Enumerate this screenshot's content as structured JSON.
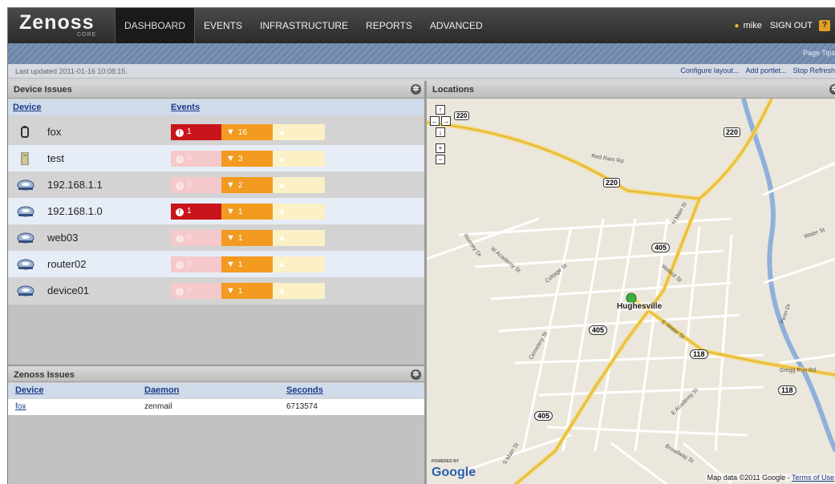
{
  "app": {
    "logo": "Zenoss",
    "logo_sub": "CORE"
  },
  "nav": [
    "DASHBOARD",
    "EVENTS",
    "INFRASTRUCTURE",
    "REPORTS",
    "ADVANCED"
  ],
  "user": {
    "name": "mike",
    "sign_out": "SIGN OUT",
    "help": "?"
  },
  "subbar": {
    "page_tips": "Page Tips"
  },
  "status": {
    "last_updated": "Last updated 2011-01-16 10:08:15.",
    "configure": "Configure layout...",
    "add_portlet": "Add portlet...",
    "stop_refresh": "Stop Refresh"
  },
  "device_issues": {
    "title": "Device Issues",
    "col_device": "Device",
    "col_events": "Events",
    "rows": [
      {
        "name": "fox",
        "icon": "battery-icon",
        "critical": "1",
        "error": "16",
        "warning": "",
        "crit_active": true
      },
      {
        "name": "test",
        "icon": "device-tower-icon",
        "critical": "0",
        "error": "3",
        "warning": "",
        "crit_active": false
      },
      {
        "name": "192.168.1.1",
        "icon": "server-disk-icon",
        "critical": "0",
        "error": "2",
        "warning": "",
        "crit_active": false
      },
      {
        "name": "192.168.1.0",
        "icon": "server-disk-icon",
        "critical": "1",
        "error": "1",
        "warning": "",
        "crit_active": true
      },
      {
        "name": "web03",
        "icon": "server-disk-icon",
        "critical": "0",
        "error": "1",
        "warning": "",
        "crit_active": false
      },
      {
        "name": "router02",
        "icon": "server-disk-icon",
        "critical": "0",
        "error": "1",
        "warning": "",
        "crit_active": false
      },
      {
        "name": "device01",
        "icon": "server-disk-icon",
        "critical": "0",
        "error": "1",
        "warning": "",
        "crit_active": false
      }
    ]
  },
  "zenoss_issues": {
    "title": "Zenoss Issues",
    "col_device": "Device",
    "col_daemon": "Daemon",
    "col_seconds": "Seconds",
    "rows": [
      {
        "device": "fox",
        "daemon": "zenmail",
        "seconds": "6713574"
      }
    ]
  },
  "locations": {
    "title": "Locations",
    "town": "Hughesville",
    "map_labels": [
      "Red Ram Rd",
      "N Main St",
      "E Water St",
      "S Main St",
      "Broadway St",
      "Gregg Run Rd",
      "E Academy St",
      "Walnut St",
      "Cemetery St",
      "W Academy St",
      "Cottage St",
      "Rooney Dr",
      "Penn Dr",
      "Water St"
    ],
    "route_shields": [
      "220",
      "220",
      "220",
      "405",
      "405",
      "405",
      "118",
      "118"
    ],
    "powered_by": "POWERED BY",
    "google": "Google",
    "map_data": "Map data ©2011 Google -",
    "terms": "Terms of Use",
    "controls": {
      "up": "↑",
      "left": "←",
      "right": "→",
      "down": "↓",
      "zoom_in": "+",
      "zoom_out": "−"
    }
  },
  "colors": {
    "critical": "#c8141a",
    "error": "#f39a20",
    "warning": "#fbf0c6",
    "nav_bg": "#2a2a2a",
    "subbar": "#7a92b3",
    "selected_row": "#e6edf7"
  }
}
